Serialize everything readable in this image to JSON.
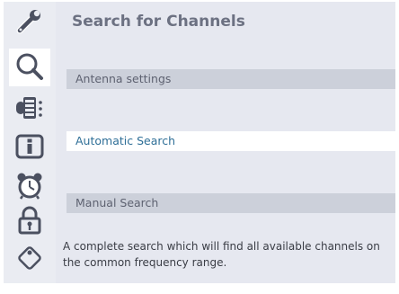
{
  "screen": {
    "title": "Search for Channels"
  },
  "sidebar": {
    "icons": [
      {
        "name": "wrench-icon"
      },
      {
        "name": "search-icon",
        "active": true
      },
      {
        "name": "channel-list-icon"
      },
      {
        "name": "info-icon"
      },
      {
        "name": "alarm-clock-icon"
      },
      {
        "name": "lock-icon"
      },
      {
        "name": "tag-icon"
      }
    ]
  },
  "menu": {
    "items": [
      {
        "label": "Antenna settings"
      },
      {
        "label": "Automatic Search",
        "selected": true
      },
      {
        "label": "Manual Search"
      }
    ]
  },
  "description": {
    "text": "A complete search which will find all available channels on the common frequency range."
  },
  "colors": {
    "background": "#e6e8f0",
    "row": "#ccd0da",
    "selected_row": "#ffffff",
    "selected_text": "#2f6f97",
    "title_text": "#6c7182"
  }
}
